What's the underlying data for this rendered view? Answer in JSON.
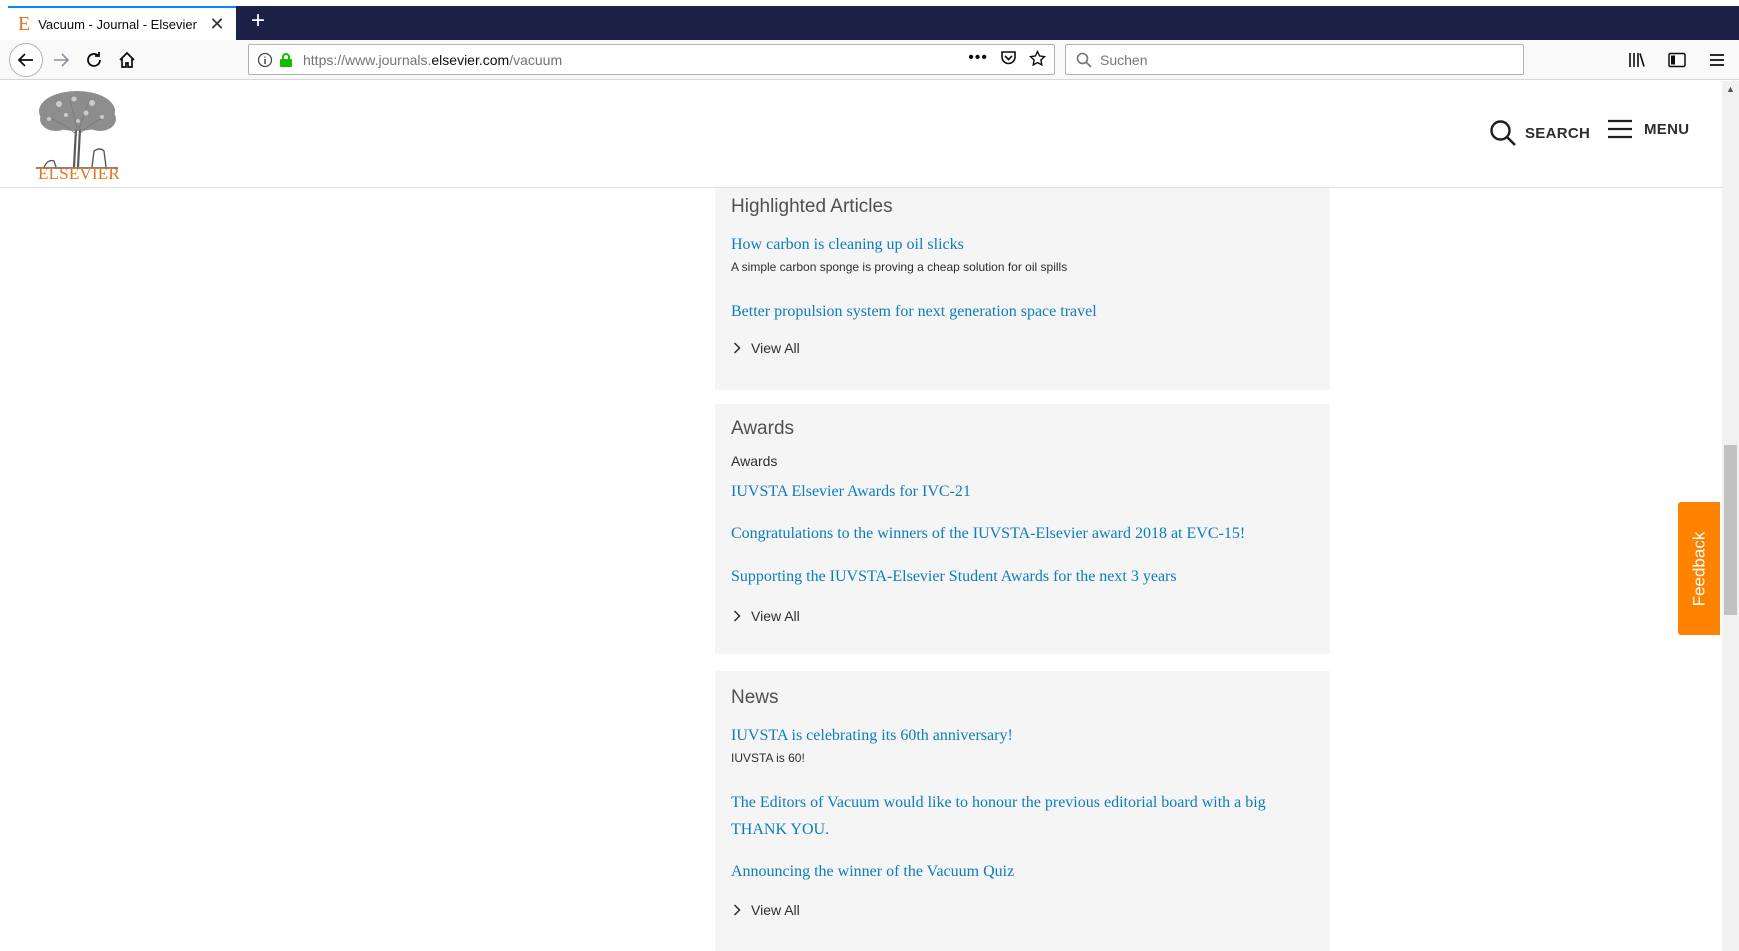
{
  "browser": {
    "tab_title": "Vacuum - Journal - Elsevier",
    "tab_favicon": "E",
    "url_prefix": "https://www.journals.",
    "url_domain": "elsevier.com",
    "url_path": "/vacuum",
    "search_placeholder": "Suchen"
  },
  "header": {
    "logo_text": "ELSEVIER",
    "search_label": "SEARCH",
    "menu_label": "MENU"
  },
  "highlighted": {
    "title": "Highlighted Articles",
    "items": [
      {
        "title": "How carbon is cleaning up oil slicks",
        "subtitle": "A simple carbon sponge is proving a cheap solution for oil spills"
      },
      {
        "title": "Better propulsion system for next generation space travel"
      }
    ],
    "view_all": "View All"
  },
  "awards": {
    "title": "Awards",
    "label": "Awards",
    "items": [
      {
        "title": "IUVSTA Elsevier Awards for IVC-21"
      },
      {
        "title": "Congratulations to the winners of the IUVSTA-Elsevier award 2018 at EVC-15!"
      },
      {
        "title": "Supporting the IUVSTA-Elsevier Student Awards for the next 3 years"
      }
    ],
    "view_all": "View All"
  },
  "news": {
    "title": "News",
    "items": [
      {
        "title": "IUVSTA is celebrating its 60th anniversary!",
        "subtitle": "IUVSTA is 60!"
      },
      {
        "title": "The Editors of Vacuum would like to honour the previous editorial board with a big THANK YOU."
      },
      {
        "title": "Announcing the winner of the Vacuum Quiz"
      }
    ],
    "view_all": "View All"
  },
  "feedback_label": "Feedback",
  "colors": {
    "link": "#0c7dbb",
    "brand_orange": "#e9711c",
    "feedback_bg": "#ff8200",
    "panel_bg": "#f5f5f5",
    "tab_strip": "#1c2147"
  }
}
